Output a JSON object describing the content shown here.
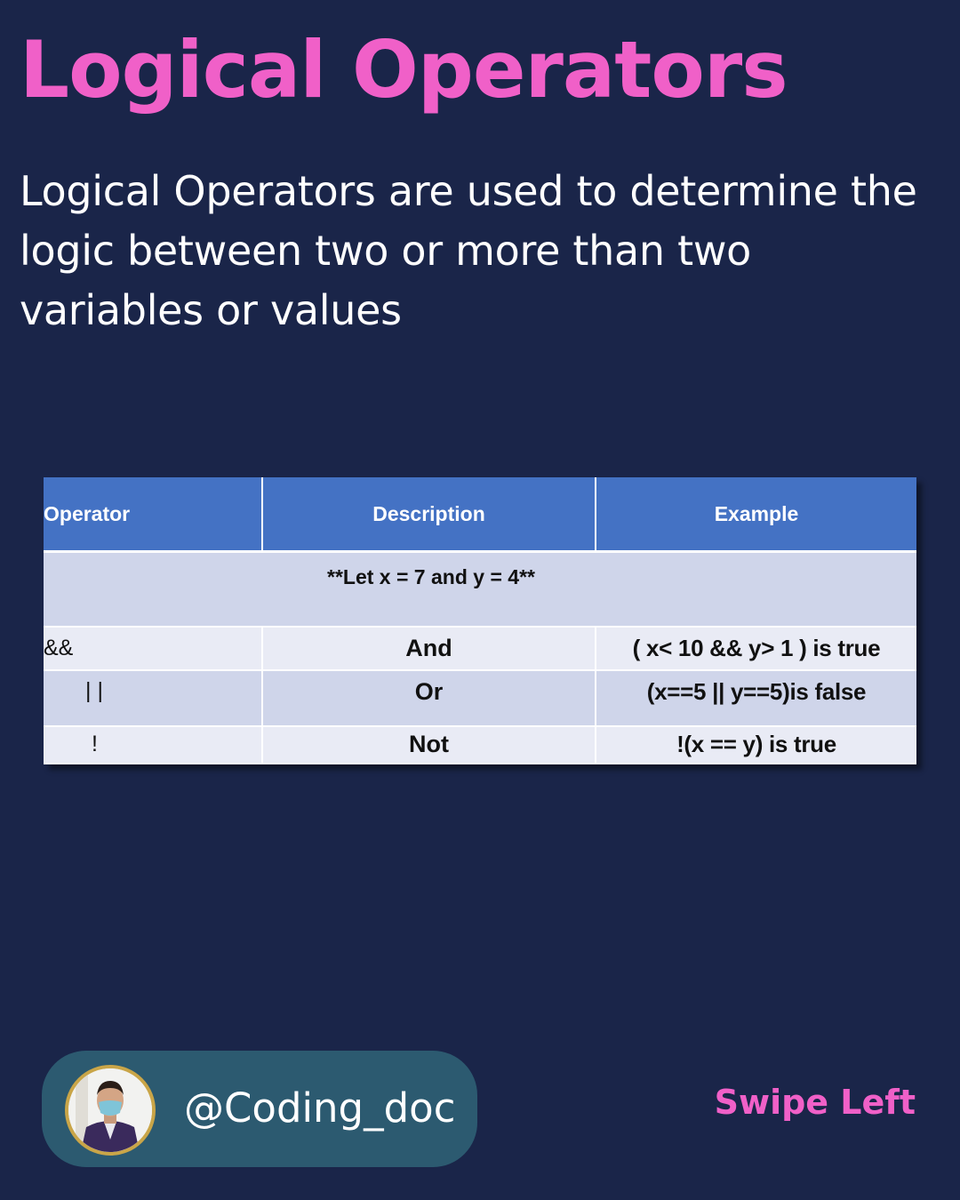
{
  "title": "Logical Operators",
  "intro": "Logical Operators are used to determine the logic between two or more than two variables or values",
  "table": {
    "headers": [
      "Operator",
      "Description",
      "Example"
    ],
    "note": "**Let x = 7 and y = 4**",
    "rows": [
      {
        "operator": "&&",
        "description": "And",
        "example": "( x< 10 && y> 1 ) is true"
      },
      {
        "operator": "| |",
        "description": "Or",
        "example": "(x==5 || y==5)is false"
      },
      {
        "operator": "!",
        "description": "Not",
        "example": "!(x == y) is true"
      }
    ]
  },
  "footer": {
    "handle": "@Coding_doc",
    "swipe_label": "Swipe Left"
  },
  "colors": {
    "background": "#1a2549",
    "accent_pink": "#f060c8",
    "table_header": "#4472c4",
    "pill": "#2c5a70"
  }
}
